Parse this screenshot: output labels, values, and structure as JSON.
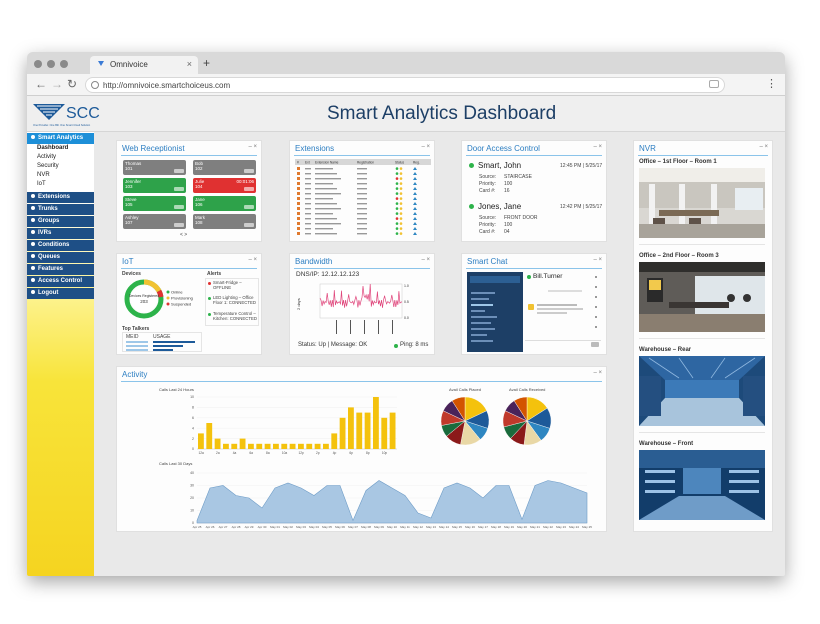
{
  "browser": {
    "tab_title": "Omnivoice",
    "new_tab": "+",
    "url": "http://omnivoice.smartchoiceus.com"
  },
  "header": {
    "logo_text": "SCC",
    "logo_tagline": "One Provider. One Bill. One Smart Cloud Solution",
    "title": "Smart Analytics Dashboard"
  },
  "sidebar": {
    "active": "Smart Analytics",
    "sub_items": [
      "Dashboard",
      "Activity",
      "Security",
      "NVR",
      "IoT"
    ],
    "items": [
      "Extensions",
      "Trunks",
      "Groups",
      "IVRs",
      "Conditions",
      "Queues",
      "Features",
      "Access Control",
      "Logout"
    ]
  },
  "panel_controls": "– ×",
  "web_receptionist": {
    "title": "Web Receptionist",
    "tiles": [
      {
        "name": "Thomas",
        "ext": "101",
        "color": "#7f7f7f"
      },
      {
        "name": "Bob",
        "ext": "102",
        "color": "#7f7f7f"
      },
      {
        "name": "Jennifer",
        "ext": "103",
        "color": "#2ea24a"
      },
      {
        "name": "Julie",
        "ext": "104",
        "color": "#e03131",
        "timer": "00:01:06"
      },
      {
        "name": "Steve",
        "ext": "105",
        "color": "#2ea24a"
      },
      {
        "name": "Jane",
        "ext": "106",
        "color": "#2ea24a"
      },
      {
        "name": "Ashley",
        "ext": "107",
        "color": "#7f7f7f"
      },
      {
        "name": "Mark",
        "ext": "108",
        "color": "#7f7f7f"
      }
    ],
    "pager": "<   >"
  },
  "extensions": {
    "title": "Extensions",
    "columns": [
      "#",
      "Ext",
      "Extension Name",
      "Registration",
      "Status",
      "Reg."
    ],
    "rows": 14
  },
  "door_access": {
    "title": "Door Access Control",
    "entries": [
      {
        "name": "Smart, John",
        "time": "12:45 PM | 5/25/17",
        "source_label": "Source:",
        "source": "STAIRCASE",
        "priority_label": "Priority:",
        "priority": "100",
        "card_label": "Card #:",
        "card": "16"
      },
      {
        "name": "Jones, Jane",
        "time": "12:42 PM | 5/25/17",
        "source_label": "Source:",
        "source": "FRONT DOOR",
        "priority_label": "Priority:",
        "priority": "100",
        "card_label": "Card #:",
        "card": "04"
      }
    ]
  },
  "iot": {
    "title": "IoT",
    "devices_label": "Devices",
    "alerts_label": "Alerts",
    "donut_label": "Devices Registered",
    "donut_value": "203",
    "legend": [
      {
        "label": "Online",
        "color": "#2db34a"
      },
      {
        "label": "Provisioning",
        "color": "#f1c232"
      },
      {
        "label": "Suspended",
        "color": "#e03131"
      }
    ],
    "alerts": [
      {
        "text": "Smart-Fridge – OFFLINE",
        "color": "#e03131"
      },
      {
        "text": "LED Lighting – Office Floor 1: CONNECTED",
        "color": "#2db34a"
      },
      {
        "text": "Temperature Control – Kitchen: CONNECTED",
        "color": "#2db34a"
      }
    ],
    "top_talkers_label": "Top Talkers",
    "talkers_cols": [
      "MEID",
      "USAGE"
    ]
  },
  "bandwidth": {
    "title": "Bandwidth",
    "dns": "DNS/IP: 12.12.12.123",
    "ylabel": "2 days",
    "ymax": "1.0",
    "ymid": "0.5",
    "ymin": "0.0",
    "status": "Status: Up | Message: OK",
    "ping": "Ping: 8 ms"
  },
  "smart_chat": {
    "title": "Smart Chat",
    "contact": "Bill.Turner"
  },
  "nvr": {
    "title": "NVR",
    "cams": [
      {
        "caption": "Office – 1st Floor – Room 1",
        "scene": "office1"
      },
      {
        "caption": "Office – 2nd Floor – Room 3",
        "scene": "office2"
      },
      {
        "caption": "Warehouse – Rear",
        "scene": "warehouse1"
      },
      {
        "caption": "Warehouse – Front",
        "scene": "warehouse2"
      }
    ]
  },
  "activity": {
    "title": "Activity",
    "bar_title": "Calls Last 24 Hours",
    "pie1_title": "Avail Calls Placed",
    "pie2_title": "Avail Calls Received",
    "line_title": "Calls Last 30 Days"
  },
  "chart_data": [
    {
      "type": "bar",
      "title": "Calls Last 24 Hours",
      "categories": [
        "12a",
        "1a",
        "2a",
        "3a",
        "4a",
        "5a",
        "6a",
        "7a",
        "8a",
        "9a",
        "10a",
        "11a",
        "12p",
        "1p",
        "2p",
        "3p",
        "4p",
        "5p",
        "6p",
        "7p",
        "8p",
        "9p",
        "10p",
        "11p"
      ],
      "values": [
        3,
        5,
        2,
        1,
        1,
        2,
        1,
        1,
        1,
        1,
        1,
        1,
        1,
        1,
        1,
        1,
        3,
        6,
        8,
        7,
        7,
        10,
        6,
        7
      ],
      "ylim": [
        0,
        10
      ],
      "color": "#f4c20d"
    },
    {
      "type": "pie",
      "title": "Avail Calls Placed",
      "values": [
        18,
        12,
        9,
        14,
        11,
        8,
        10,
        9,
        9
      ],
      "colors": [
        "#f4c20d",
        "#1d5a99",
        "#2e86c1",
        "#e9d8a6",
        "#8b1a1a",
        "#1a6b3c",
        "#c0392b",
        "#4a235a",
        "#d35400"
      ]
    },
    {
      "type": "pie",
      "title": "Avail Calls Received",
      "values": [
        16,
        14,
        10,
        12,
        10,
        9,
        11,
        9,
        9
      ],
      "colors": [
        "#f4c20d",
        "#1d5a99",
        "#2e86c1",
        "#e9d8a6",
        "#8b1a1a",
        "#1a6b3c",
        "#c0392b",
        "#4a235a",
        "#d35400"
      ]
    },
    {
      "type": "area",
      "title": "Calls Last 30 Days",
      "x": [
        "Apr 25",
        "Apr 26",
        "Apr 27",
        "Apr 28",
        "Apr 29",
        "Apr 30",
        "May 01",
        "May 02",
        "May 03",
        "May 04",
        "May 05",
        "May 06",
        "May 07",
        "May 08",
        "May 09",
        "May 10",
        "May 11",
        "May 12",
        "May 13",
        "May 14",
        "May 15",
        "May 16",
        "May 17",
        "May 18",
        "May 19",
        "May 20",
        "May 21",
        "May 22",
        "May 23",
        "May 24",
        "May 25"
      ],
      "values": [
        2,
        28,
        30,
        22,
        20,
        12,
        28,
        32,
        28,
        22,
        30,
        30,
        2,
        26,
        34,
        28,
        22,
        8,
        4,
        28,
        32,
        28,
        20,
        30,
        30,
        3,
        30,
        34,
        32,
        28,
        24
      ],
      "ylim": [
        0,
        40
      ],
      "color": "#a9c7e3"
    }
  ]
}
